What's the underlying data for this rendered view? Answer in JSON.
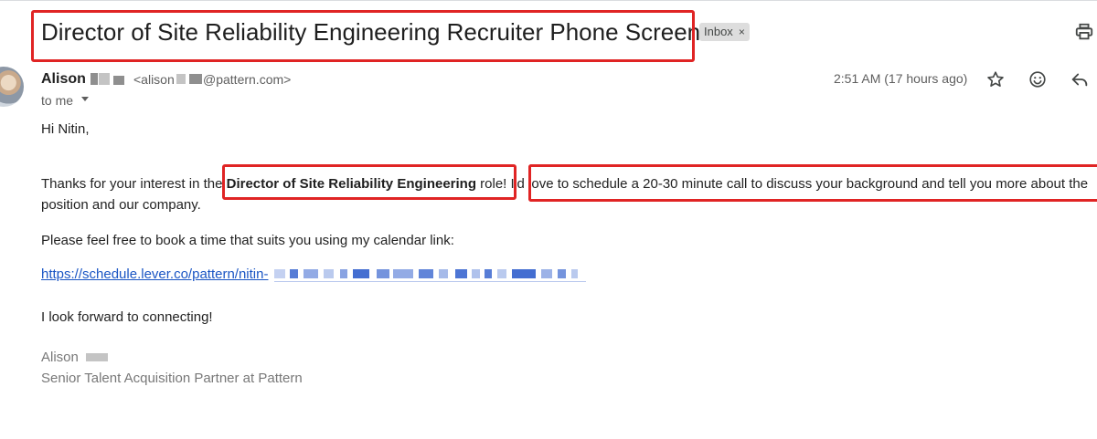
{
  "email": {
    "subject": "Director of Site Reliability Engineering Recruiter Phone Screen",
    "label_chip": "Inbox",
    "label_chip_close": "×",
    "sender": {
      "name": "Alison",
      "email_prefix": "<alison",
      "email_domain": "@pattern.com>"
    },
    "recipient": "to me",
    "timestamp": "2:51 AM (17 hours ago)",
    "body": {
      "greeting": "Hi Nitin,",
      "p1_before": "Thanks for your interest in the ",
      "p1_role": "Director of Site Reliability Engineering",
      "p1_after": " role! I'd love to schedule a 20-30 minute call to discuss your background and tell you more about the",
      "p1_line2": "position and our company.",
      "p2": "Please feel free to book a time that suits you using my calendar link:",
      "link_text": "https://schedule.lever.co/pattern/nitin-",
      "p3": "I look forward to connecting!"
    },
    "signature": {
      "name": "Alison",
      "title": "Senior Talent Acquisition Partner at Pattern"
    }
  },
  "icons": {
    "print": "print-icon",
    "star": "star-icon",
    "emoji": "emoji-icon",
    "reply": "reply-icon"
  },
  "colors": {
    "annotation_red": "#e02424",
    "link_blue": "#1a55c4",
    "chip_bg": "#dddddd"
  }
}
